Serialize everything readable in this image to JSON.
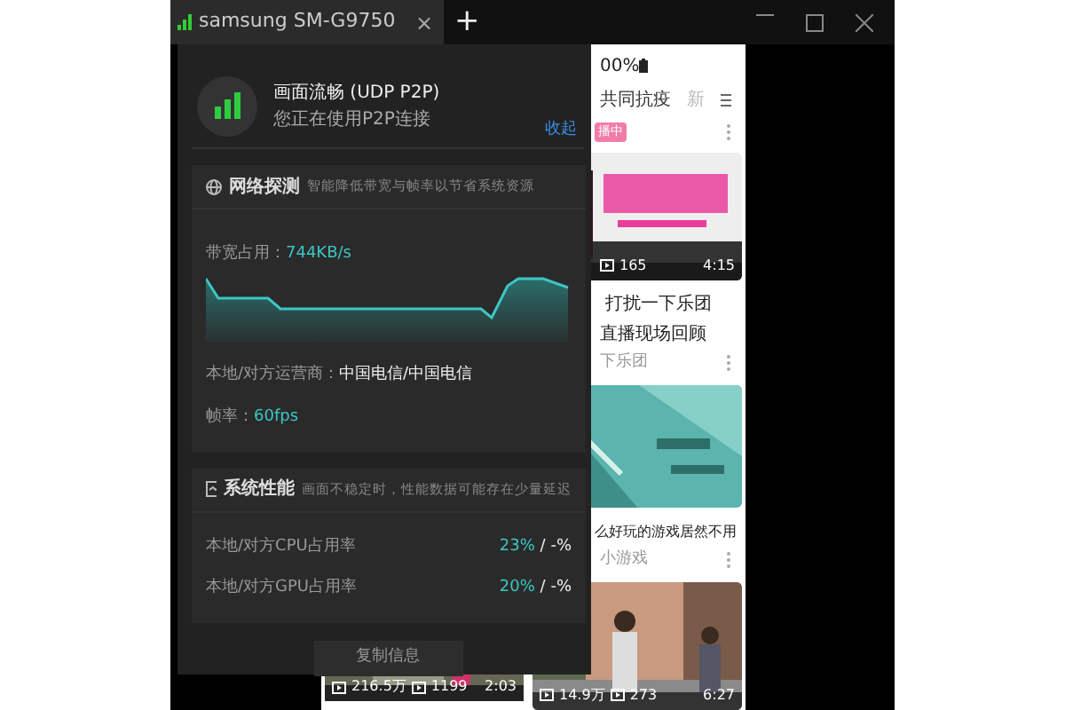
{
  "tab": {
    "title": "samsung SM-G9750",
    "close": "×",
    "selected": true
  },
  "new_tab": "+",
  "phone": {
    "status": "00%",
    "nav_tabs": [
      {
        "label": "共同抗疫",
        "faded": false
      },
      {
        "label": "新",
        "faded": true
      }
    ],
    "left_cards": [
      {
        "stats": [
          "216.5万",
          "1199"
        ],
        "duration": "2:03"
      }
    ],
    "right_tag": "播中",
    "right_cards": [
      {
        "stats": [
          "165"
        ],
        "duration": "4:15",
        "title_lines": [
          " 打扰一下乐团",
          "直播现场回顾"
        ],
        "author": "下乐团"
      },
      {
        "title_lines": [
          "么好玩的游戏居然不用"
        ],
        "author": "小游戏"
      },
      {
        "stats": [
          "14.9万",
          "273"
        ],
        "duration": "6:27"
      }
    ]
  },
  "overlay": {
    "title": "画面流畅 (UDP P2P)",
    "subtitle": "您正在使用P2P连接",
    "collapse": "收起",
    "network": {
      "heading": "网络探测",
      "hint": "智能降低带宽与帧率以节省系统资源",
      "rows": [
        {
          "label": "带宽占用：",
          "value": "744KB/s",
          "accent": true
        },
        {
          "label": "本地/对方运营商：",
          "value": "中国电信/中国电信",
          "accent": false
        },
        {
          "label": "帧率：",
          "value": "60fps",
          "accent": true
        }
      ]
    },
    "performance": {
      "heading": "系统性能",
      "hint": "画面不稳定时，性能数据可能存在少量延迟",
      "rows": [
        {
          "label": "本地/对方CPU占用率",
          "local": "23%",
          "remote": " / -%"
        },
        {
          "label": "本地/对方GPU占用率",
          "local": "20%",
          "remote": " / -%"
        }
      ]
    },
    "copy_button": "复制信息"
  }
}
